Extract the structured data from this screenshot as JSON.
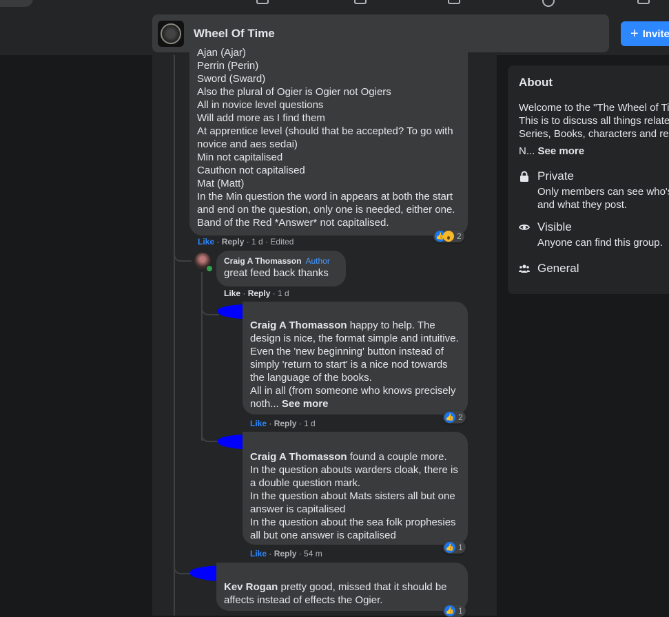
{
  "group": {
    "name": "Wheel Of Time",
    "invite_label": "Invite"
  },
  "about": {
    "title": "About",
    "description_lines": [
      "Welcome to the \"The Wheel of Ti",
      "This is to discuss all things relatec",
      "Series, Books, characters and rela"
    ],
    "ellipsis": "N...",
    "see_more": "See more",
    "private_title": "Private",
    "private_desc_lines": [
      "Only members can see who's",
      "and what they post."
    ],
    "visible_title": "Visible",
    "visible_desc": "Anyone can find this group.",
    "general_title": "General"
  },
  "comment1": {
    "lines": [
      "Ajan (Ajar)",
      "Perrin (Perin)",
      "Sword (Sward)",
      "Also the plural of Ogier is Ogier not Ogiers",
      "All in novice level questions",
      "Will add more as I find them",
      "At apprentice level (should that be accepted? To go with",
      "novice and aes sedai)",
      "Min not capitalised",
      "Cauthon not capitalised",
      "Mat (Matt)",
      "In the Min question the word in appears at both the start",
      "and end on the question, only one is needed, either one.",
      "Band of the Red *Answer* not capitalised."
    ],
    "like": "Like",
    "reply": "Reply",
    "time": "1 d",
    "edited": "Edited",
    "reactions": "2"
  },
  "comment2": {
    "author": "Craig A Thomasson",
    "badge": "Author",
    "text": "great feed back thanks",
    "like": "Like",
    "reply": "Reply",
    "time": "1 d"
  },
  "comment3": {
    "mention": "Craig A Thomasson",
    "first_line_rest": " happy to help. The",
    "lines": [
      "design is nice, the format simple and intuitive.",
      "Even the 'new beginning' button instead of",
      "simply 'return to start' is a nice nod towards",
      "the language of the books.",
      "All in all (from someone who knows precisely"
    ],
    "last_line": "noth...",
    "see_more": "See more",
    "like": "Like",
    "reply": "Reply",
    "time": "1 d",
    "reactions": "2"
  },
  "comment4": {
    "mention": "Craig A Thomasson",
    "first_line_rest": " found a couple more.",
    "lines": [
      "In the question abouts warders cloak, there is",
      "a double question mark.",
      "In the question about Mats sisters all but one",
      "answer is capitalised",
      "In the question about the sea folk prophesies",
      "all but one answer is capitalised"
    ],
    "like": "Like",
    "reply": "Reply",
    "time": "54 m",
    "reactions": "1"
  },
  "comment5": {
    "mention": "Kev Rogan",
    "first_line_rest": " pretty good, missed that it should be",
    "lines": [
      "affects instead of effects the Ogier."
    ],
    "reactions": "1"
  },
  "colors": {
    "accent": "#2d88ff",
    "background": "#18191a",
    "surface": "#242526",
    "bubble": "#3a3b3c",
    "redaction": "#0000ff"
  }
}
